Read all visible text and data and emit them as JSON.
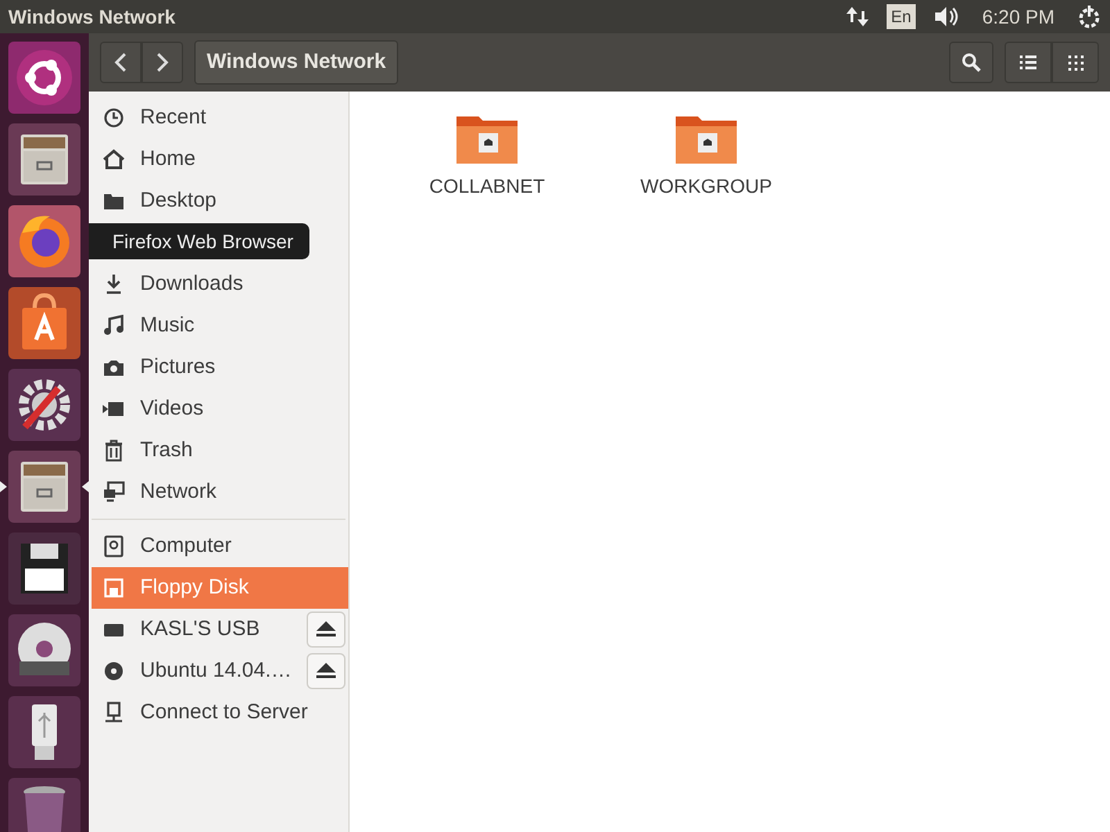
{
  "top_panel": {
    "title": "Windows Network",
    "keyboard": "En",
    "clock": "6:20 PM"
  },
  "launcher": [
    {
      "kind": "ubuntu",
      "running": false
    },
    {
      "kind": "files",
      "running": false
    },
    {
      "kind": "firefox",
      "running": false
    },
    {
      "kind": "software",
      "running": false
    },
    {
      "kind": "settings",
      "running": false
    },
    {
      "kind": "files",
      "running": true
    },
    {
      "kind": "floppy",
      "running": false
    },
    {
      "kind": "dvd",
      "running": false
    },
    {
      "kind": "usb",
      "running": false
    },
    {
      "kind": "trash",
      "running": false
    }
  ],
  "tooltip": {
    "text": "Firefox Web Browser"
  },
  "toolbar": {
    "path": "Windows Network",
    "view_list_selected": false,
    "view_grid_selected": false
  },
  "sidebar": {
    "groups": [
      [
        {
          "kind": "recent",
          "label": "Recent",
          "selected": false
        },
        {
          "kind": "home",
          "label": "Home",
          "selected": false
        },
        {
          "kind": "folder",
          "label": "Desktop",
          "selected": false
        },
        {
          "kind": "covered",
          "selected": false
        },
        {
          "kind": "download",
          "label": "Downloads",
          "selected": false
        },
        {
          "kind": "music",
          "label": "Music",
          "selected": false
        },
        {
          "kind": "camera",
          "label": "Pictures",
          "selected": false
        },
        {
          "kind": "video",
          "label": "Videos",
          "selected": false
        },
        {
          "kind": "trash",
          "label": "Trash",
          "selected": false
        },
        {
          "kind": "network",
          "label": "Network",
          "selected": false
        }
      ],
      [
        {
          "kind": "computer",
          "label": "Computer",
          "selected": false
        },
        {
          "kind": "floppy",
          "label": "Floppy Disk",
          "selected": true
        },
        {
          "kind": "drive",
          "label": "KASL'S USB",
          "selected": false,
          "eject": true
        },
        {
          "kind": "disc",
          "label": "Ubuntu 14.04.…",
          "selected": false,
          "eject": true
        },
        {
          "kind": "server",
          "label": "Connect to Server",
          "selected": false
        }
      ]
    ]
  },
  "files": [
    {
      "name": "COLLABNET"
    },
    {
      "name": "WORKGROUP"
    }
  ]
}
